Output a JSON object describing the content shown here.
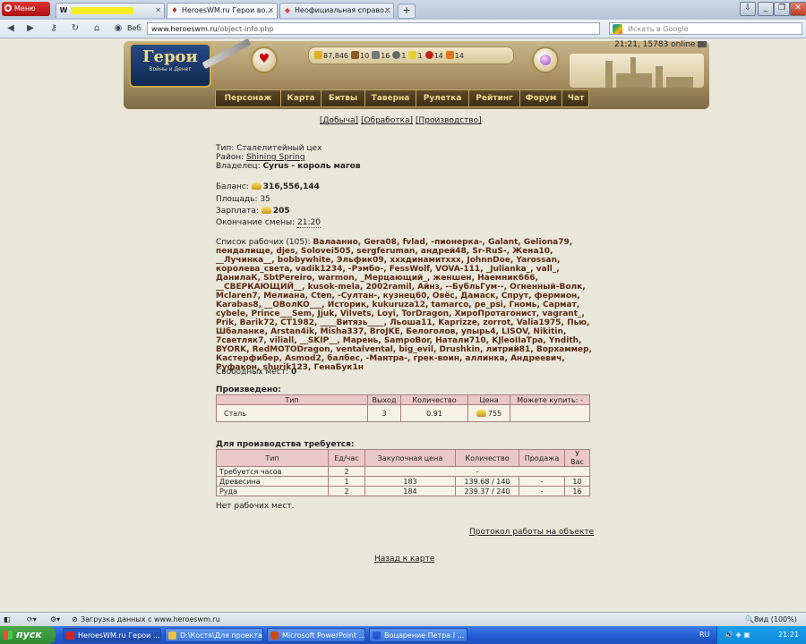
{
  "browser": {
    "menu_label": "Меню",
    "tabs": [
      {
        "favicon": "W",
        "title": ""
      },
      {
        "favicon": "♦",
        "title": "HeroesWM.ru Герои во..."
      },
      {
        "favicon": "◆",
        "title": "Неофициальная справо..."
      }
    ],
    "web_label": "Веб",
    "url_host": "www.heroeswm.ru",
    "url_path": "/object-info.php",
    "search_placeholder": "Искать в Google"
  },
  "site": {
    "logo_title": "Герои",
    "logo_subtitle": "Войны и Денег",
    "clock": "21:21, 15783 online",
    "resources": [
      {
        "icon": "gold-icon",
        "color": "#e0b020",
        "value": "87,846"
      },
      {
        "icon": "wood-icon",
        "color": "#8a5a2a",
        "value": "10"
      },
      {
        "icon": "ore-icon",
        "color": "#777777",
        "value": "16"
      },
      {
        "icon": "mercury-icon",
        "color": "#666666",
        "value": "1"
      },
      {
        "icon": "sulfur-icon",
        "color": "#e8d030",
        "value": "1"
      },
      {
        "icon": "crystal-icon",
        "color": "#c02020",
        "value": "14"
      },
      {
        "icon": "gems-icon",
        "color": "#e07820",
        "value": "14"
      }
    ],
    "menu": [
      "Персонаж",
      "Карта",
      "Битвы",
      "Таверна",
      "Рулетка",
      "Рейтинг",
      "Форум",
      "Чат"
    ]
  },
  "object": {
    "tab_links": [
      "[Добыча]",
      "[Обработка]",
      "[Производство]"
    ],
    "type_label": "Тип:",
    "type_value": "Сталелитейный цех",
    "district_label": "Район:",
    "district_value": "Shining Spring",
    "owner_label": "Владелец:",
    "owner_value": "Cyrus - король магов",
    "balance_label": "Баланс:",
    "balance_value": "316,556,144",
    "area_label": "Площадь:",
    "area_value": "35",
    "salary_label": "Зарплата:",
    "salary_value": "205",
    "shift_label": "Окончание смены:",
    "shift_value": "21:20",
    "workers_label": "Список рабочих (105):",
    "workers_text": "Валаанно, Gera08, fvlad, -пионерка-, Galant, Geliona79, пендалище, djes, Solovei505, sergferuman, андрей48, Sr-RuS-, Жена10, __Лучинка__, bobbywhite, Эльфик09, хххдинамитххх, JohnnDoe, Yarossan, королева_света, vadik1234, -Рэмбо-, FessWolf, VOVA-111, _Julianka_, vall_, ДанилаК, SbtPereiro, warmon, _Мерцающий_, женшен, Наемник666, __СВЕРКАЮЩИЙ__, kusok-mela, 2002ramil, Айнз, --БубльГум--, Огненный-Волк, Mclaren7, Мелиана, Cten, -Султан-, кузнец60, Овёс, Дамаск, Спрут, фермион, Karabas8, __OBoлKO___, Историк, kukuruza12, tamarco, pe_psi, Гномь, Сармат, cybele, Prince___Sem, Jjuk, Vilvets, Loyi, TorDragon, ХироПротагонист, vagrant_, Prik, Barik72, CT1982, ____Витязь____, Льоша11, Kaprizze, zorrot, Valia1975, Пью, Шбаланке, Arstan4ik, Misha337, BroJKE, Белоголов, упырь4, LISOV, Nikitin, 7светляк7, viliall, __SKIP__, Марень, SampoBor, Натали710, KJleoIIaTpa, Yndith, BYORK, RedMOTODragon, ventalvental, big_evil, Drushkin, литрий81, Ворхаммер, Кастерфибер, Asmod2, балбес, -Мантра-, грек-воин, аллинка, Андреевич, Руфакон, shurik123, ГенаБук1н",
    "free_places_label": "Свободных мест:",
    "free_places_value": "0",
    "produced": {
      "title": "Произведено:",
      "headers": [
        "Тип",
        "Выход",
        "Количество",
        "Цена",
        "Можете купить: -"
      ],
      "row": [
        "Сталь",
        "3",
        "0.91",
        "755"
      ]
    },
    "required": {
      "title": "Для производства требуется:",
      "headers": [
        "Тип",
        "Ед/час",
        "Закупочная цена",
        "Количество",
        "Продажа",
        "У Вас"
      ],
      "rows": [
        [
          "Требуется часов",
          "2",
          "",
          "-",
          "",
          ""
        ],
        [
          "Древесина",
          "1",
          "183",
          "139.68 / 140",
          "-",
          "10"
        ],
        [
          "Руда",
          "2",
          "184",
          "239.37 / 240",
          "-",
          "16"
        ]
      ]
    },
    "no_workers": "Нет рабочих мест.",
    "protocol_link": "Протокол работы на объекте",
    "back_link": "Назад к карте"
  },
  "status": {
    "loading_text": "Загрузка данных с www.heroeswm.ru",
    "zoom": "Вид (100%)"
  },
  "taskbar": {
    "start_label": "пуск",
    "tasks": [
      {
        "label": "HeroesWM.ru Герои ...",
        "color": "#d22"
      },
      {
        "label": "D:\\Костя\\Для проекта",
        "color": "#f0c040"
      },
      {
        "label": "Microsoft PowerPoint ...",
        "color": "#d04a10"
      },
      {
        "label": "Воцарение Петра I ...",
        "color": "#2a5ad0"
      }
    ],
    "lang": "RU",
    "time": "21:21"
  }
}
